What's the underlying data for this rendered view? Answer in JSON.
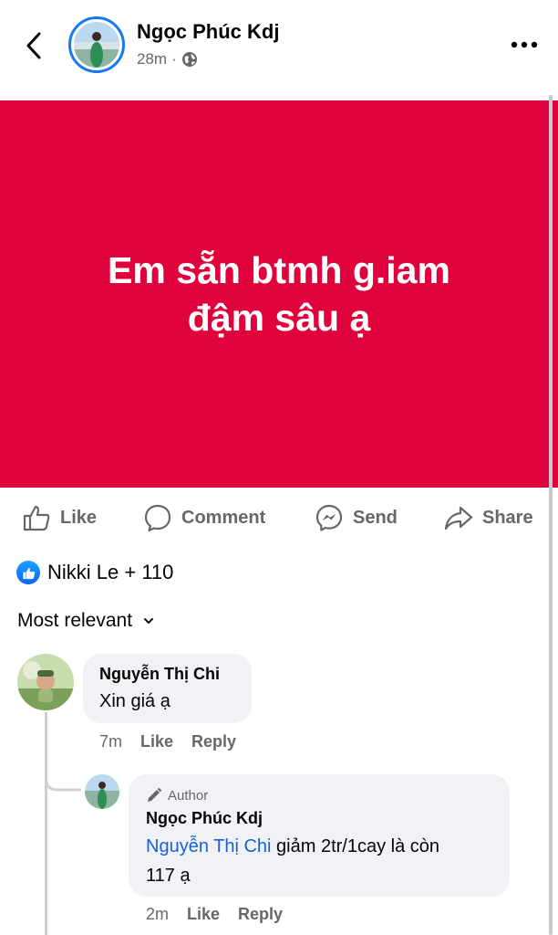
{
  "header": {
    "author_name": "Ngọc Phúc Kdj",
    "time": "28m",
    "separator": "·",
    "privacy_icon": "globe-icon",
    "back_icon": "chevron-left-icon",
    "more_icon": "more-horizontal-icon"
  },
  "post": {
    "text_line1": "Em sẵn btmh g.iam",
    "text_line2": "đậm sâu ạ",
    "background_color": "#e0023c"
  },
  "actions": [
    {
      "label": "Like",
      "icon": "thumbs-up-icon"
    },
    {
      "label": "Comment",
      "icon": "comment-icon"
    },
    {
      "label": "Send",
      "icon": "messenger-icon"
    },
    {
      "label": "Share",
      "icon": "share-icon"
    }
  ],
  "reactions": {
    "summary": "Nikki Le + 110",
    "icon": "like-reaction-icon"
  },
  "sort": {
    "label": "Most relevant",
    "icon": "chevron-down-icon"
  },
  "comments": [
    {
      "name": "Nguyễn Thị Chi",
      "text": "Xin giá ạ",
      "time": "7m",
      "like_label": "Like",
      "reply_label": "Reply"
    }
  ],
  "reply": {
    "badge": "Author",
    "badge_icon": "pen-icon",
    "name": "Ngọc Phúc Kdj",
    "mention": "Nguyễn Thị Chi",
    "text_after_mention": " giảm 2tr/1cay là còn",
    "text_line2": "117 ạ",
    "time": "2m",
    "like_label": "Like",
    "reply_label": "Reply"
  },
  "colors": {
    "accent": "#1877f2",
    "mention": "#1a5fd6",
    "muted": "#65676b",
    "bubble": "#f0f2f5"
  }
}
